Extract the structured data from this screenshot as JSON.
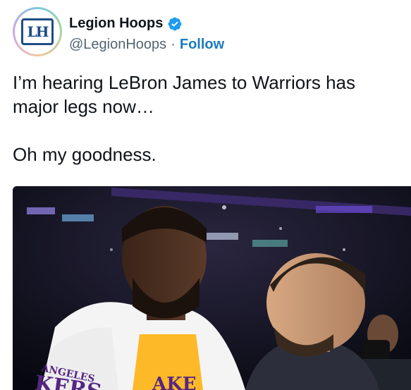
{
  "tweet": {
    "display_name": "Legion Hoops",
    "handle": "@LegionHoops",
    "separator": "·",
    "follow_label": "Follow",
    "verified": true,
    "avatar_logo": "LH",
    "text": "I’m hearing LeBron James to Warriors has\nmajor legs now…\n\nOh my goodness.",
    "media": {
      "type": "photo",
      "jersey_text_left": "ANGELES",
      "jersey_text_left_big": "KERS",
      "jersey_text_center": "AKE",
      "accent_purple": "#552583",
      "accent_gold": "#FDB927"
    }
  },
  "colors": {
    "text": "#0f1419",
    "secondary": "#536471",
    "follow": "#1d7bbf",
    "verified": "#1d9bf0"
  }
}
